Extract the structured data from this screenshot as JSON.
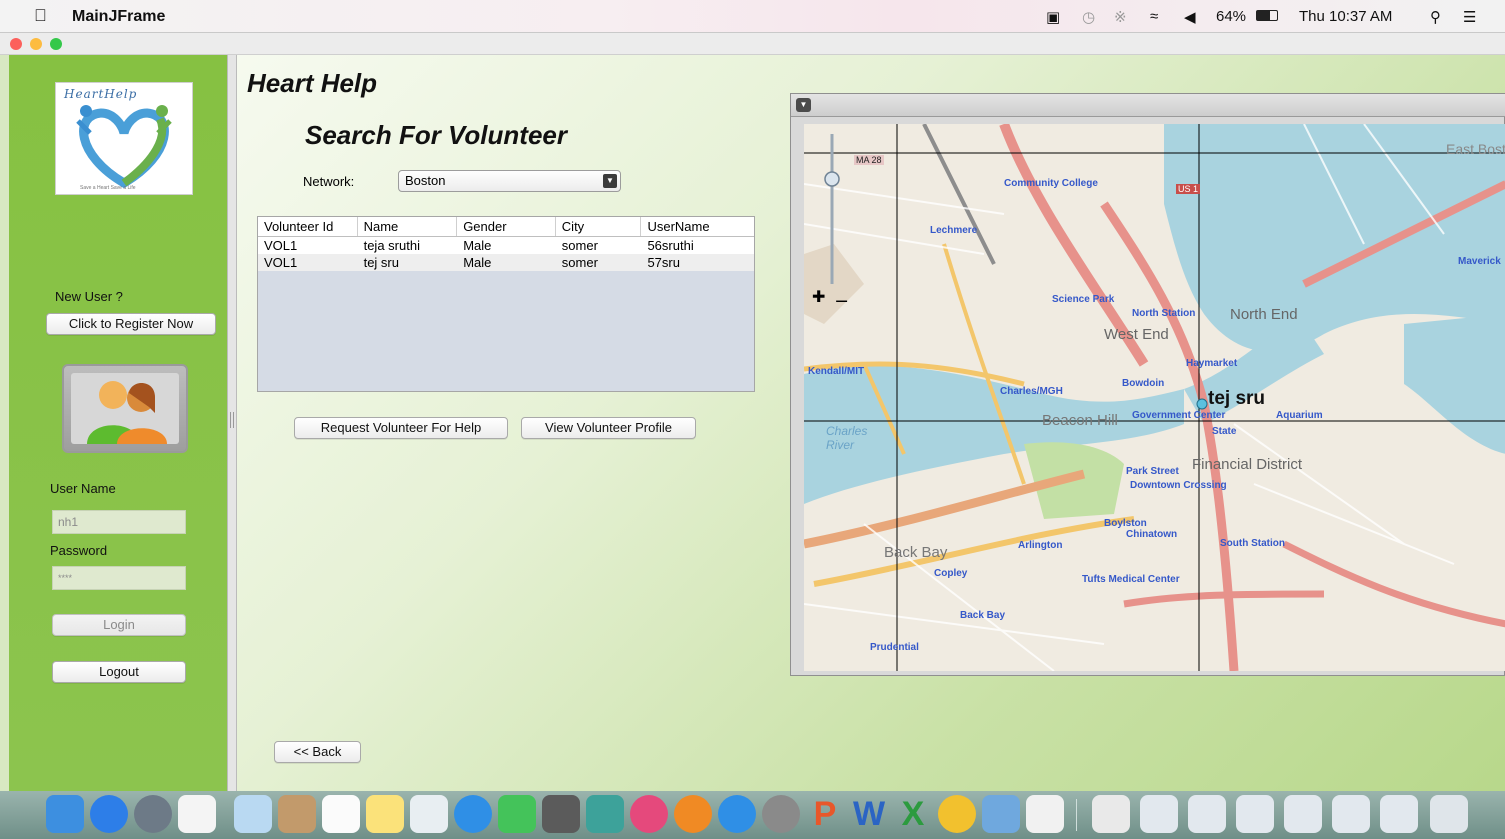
{
  "menubar": {
    "app_name": "MainJFrame",
    "battery": "64%",
    "clock": "Thu 10:37 AM"
  },
  "sidebar": {
    "logo_title": "HeartHelp",
    "logo_tagline": "Save a Heart Save a Life",
    "new_user_label": "New User ?",
    "register_button": "Click to Register Now",
    "username_label": "User Name",
    "username_value": "nh1",
    "password_label": "Password",
    "password_value": "****",
    "login_button": "Login",
    "logout_button": "Logout"
  },
  "main": {
    "app_title": "Heart Help",
    "page_title": "Search For Volunteer",
    "network_label": "Network:",
    "network_value": "Boston",
    "table": {
      "columns": [
        "Volunteer Id",
        "Name",
        "Gender",
        "City",
        "UserName"
      ],
      "rows": [
        [
          "VOL1",
          "teja sruthi",
          "Male",
          "somer",
          "56sruthi"
        ],
        [
          "VOL1",
          "tej sru",
          "Male",
          "somer",
          "57sru"
        ]
      ]
    },
    "request_button": "Request Volunteer For Help",
    "view_profile_button": "View Volunteer Profile",
    "back_button": "<< Back"
  },
  "map": {
    "marker_label": "tej sru",
    "labels": {
      "community_college": "Community College",
      "lechmere": "Lechmere",
      "science_park": "Science Park",
      "north_station": "North Station",
      "north_end": "North End",
      "west_end": "West End",
      "haymarket": "Haymarket",
      "kendall": "Kendall/MIT",
      "charles_mgh": "Charles/MGH",
      "bowdoin": "Bowdoin",
      "beacon_hill": "Beacon Hill",
      "government_center": "Government Center",
      "aquarium": "Aquarium",
      "state": "State",
      "financial_district": "Financial District",
      "park_street": "Park Street",
      "downtown_crossing": "Downtown Crossing",
      "boylston": "Boylston",
      "chinatown": "Chinatown",
      "south_station": "South Station",
      "arlington": "Arlington",
      "back_bay_area": "Back Bay",
      "copley": "Copley",
      "tufts": "Tufts Medical Center",
      "back_bay_station": "Back Bay",
      "prudential": "Prudential",
      "east_boston": "East Bost",
      "maverick": "Maverick",
      "charles_river": "Charles River",
      "ma28": "MA 28",
      "us1": "US 1"
    }
  }
}
